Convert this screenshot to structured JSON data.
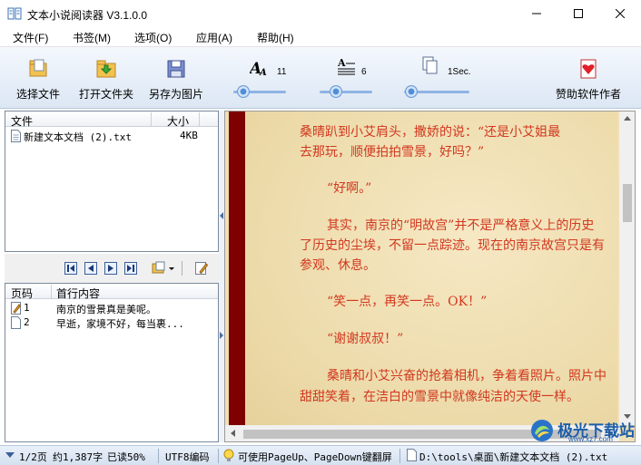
{
  "window": {
    "title": "文本小说阅读器 V3.1.0.0"
  },
  "menu": [
    "文件(F)",
    "书签(M)",
    "选项(O)",
    "应用(A)",
    "帮助(H)"
  ],
  "toolbar": {
    "choose_file": "选择文件",
    "open_folder": "打开文件夹",
    "save_as_image": "另存为图片",
    "font_size": "11",
    "line_spacing": "6",
    "interval": "1Sec.",
    "donate": "赞助软件作者"
  },
  "file_list": {
    "columns": [
      "文件",
      "大小"
    ],
    "rows": [
      {
        "name": "新建文本文档 (2).txt",
        "size": "4KB"
      }
    ]
  },
  "page_list": {
    "columns": [
      "页码",
      "首行内容"
    ],
    "rows": [
      {
        "page": "1",
        "content": "南京的雪景真是美呢。"
      },
      {
        "page": "2",
        "content": "早逝，家境不好，每当裹..."
      }
    ]
  },
  "reader": {
    "paragraphs": [
      "桑晴趴到小艾肩头，撒娇的说：“还是小艾姐最",
      "去那玩，顺便拍拍雪景，好吗？”",
      "“好啊。”",
      "其实，南京的“明故宫”并不是严格意义上的历史",
      "了历史的尘埃，不留一点踪迹。现在的南京故宫只是有",
      "参观、休息。",
      "“笑一点，再笑一点。OK！”",
      "“谢谢叔叔！”",
      "桑晴和小艾兴奋的抢着相机，争着看照片。照片中",
      "甜甜笑着，在洁白的雪景中就像纯洁的天使一样。"
    ]
  },
  "status": {
    "page": "1/2页",
    "chars": "约1,387字",
    "read": "已读50%",
    "encoding": "UTF8编码",
    "tip": "可使用PageUp、PageDown键翻屏",
    "path": "D:\\tools\\桌面\\新建文本文档 (2).txt"
  },
  "watermark": {
    "text": "极光下载站",
    "url": "www.xz7.com"
  }
}
